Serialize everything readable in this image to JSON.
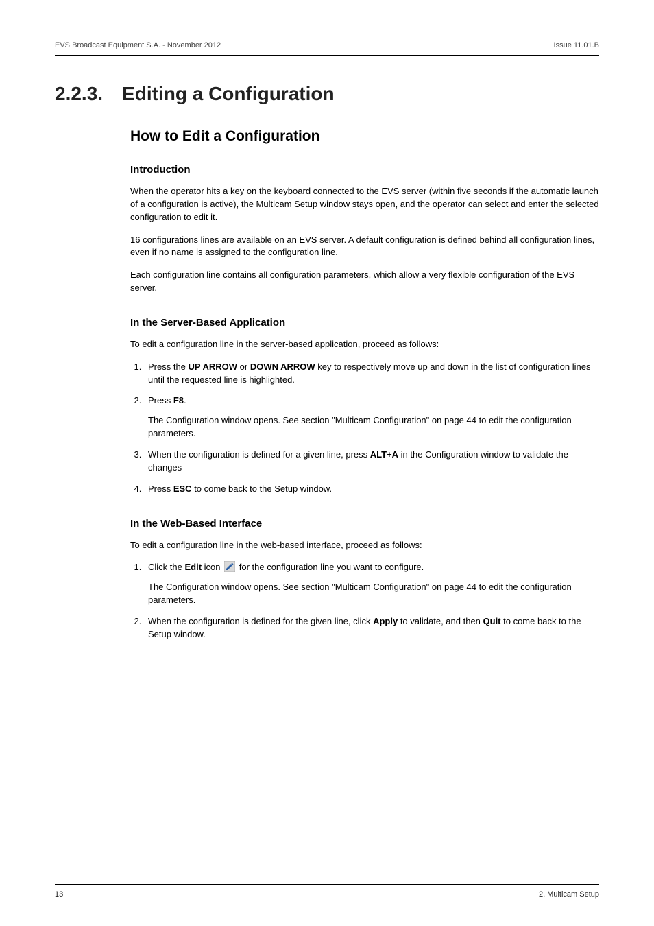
{
  "header": {
    "left": "EVS Broadcast Equipment S.A.  - November 2012",
    "right": "Issue 11.01.B"
  },
  "section": {
    "number": "2.2.3.",
    "title": "Editing a Configuration"
  },
  "h2_how_to": "How to Edit a Configuration",
  "intro": {
    "heading": "Introduction",
    "p1": "When the operator hits a key on the keyboard connected to the EVS server (within five seconds if the automatic launch of a configuration is active), the Multicam Setup window stays open, and the operator can select and enter the selected configuration to edit it.",
    "p2": "16 configurations lines are available on an EVS server. A default configuration is defined behind all configuration lines, even if no name is assigned to the configuration line.",
    "p3": "Each configuration line contains all configuration parameters, which allow a very flexible configuration of the EVS server."
  },
  "server_based": {
    "heading": "In the Server-Based Application",
    "lead": "To edit a configuration line in the server-based application, proceed as follows:",
    "step1_a": "Press the ",
    "step1_b": " or ",
    "step1_c": " key to respectively move up and down in the list of configuration lines until the requested line is highlighted.",
    "key_up": "UP ARROW",
    "key_down": "DOWN ARROW",
    "step2_a": "Press ",
    "step2_b": ".",
    "key_f8": "F8",
    "step2_sub": "The Configuration window opens. See section \"Multicam Configuration\" on page 44 to edit the configuration parameters.",
    "step3_a": "When the configuration is defined for a given line, press ",
    "step3_b": " in the Configuration window to validate the changes",
    "key_alta": "ALT+A",
    "step4_a": "Press ",
    "step4_b": " to come back to the Setup window.",
    "key_esc": "ESC"
  },
  "web_based": {
    "heading": "In the Web-Based Interface",
    "lead": "To edit a configuration line in the web-based interface, proceed as follows:",
    "step1_a": "Click the ",
    "step1_b": " icon ",
    "step1_c": " for the configuration line you want to configure.",
    "key_edit": "Edit",
    "step1_sub": "The Configuration window opens. See section \"Multicam Configuration\" on page 44 to edit the configuration parameters.",
    "step2_a": "When the configuration is defined for the given line, click ",
    "step2_b": " to validate, and then ",
    "step2_c": " to come back to the Setup window.",
    "key_apply": "Apply",
    "key_quit": "Quit"
  },
  "footer": {
    "left": "13",
    "right": "2. Multicam Setup"
  }
}
